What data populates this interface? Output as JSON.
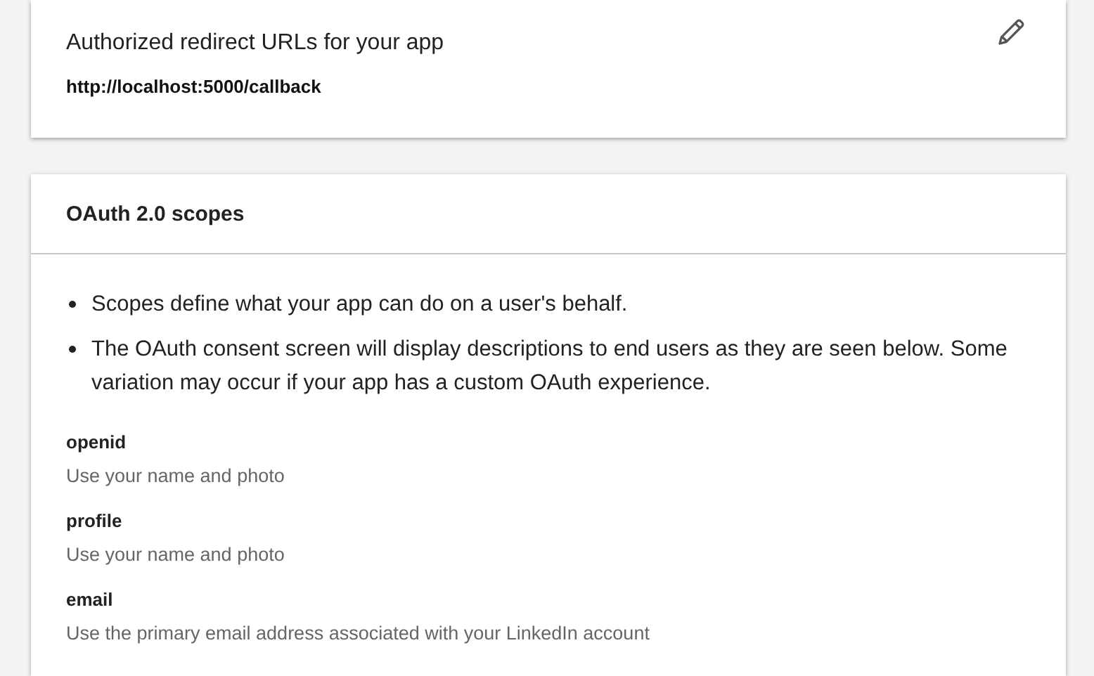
{
  "redirect_card": {
    "title": "Authorized redirect URLs for your app",
    "urls": [
      "http://localhost:5000/callback"
    ]
  },
  "scopes_card": {
    "title": "OAuth 2.0 scopes",
    "notes": [
      "Scopes define what your app can do on a user's behalf.",
      "The OAuth consent screen will display descriptions to end users as they are seen below. Some variation may occur if your app has a custom OAuth experience."
    ],
    "scopes": [
      {
        "name": "openid",
        "description": "Use your name and photo"
      },
      {
        "name": "profile",
        "description": "Use your name and photo"
      },
      {
        "name": "email",
        "description": "Use the primary email address associated with your LinkedIn account"
      }
    ]
  }
}
